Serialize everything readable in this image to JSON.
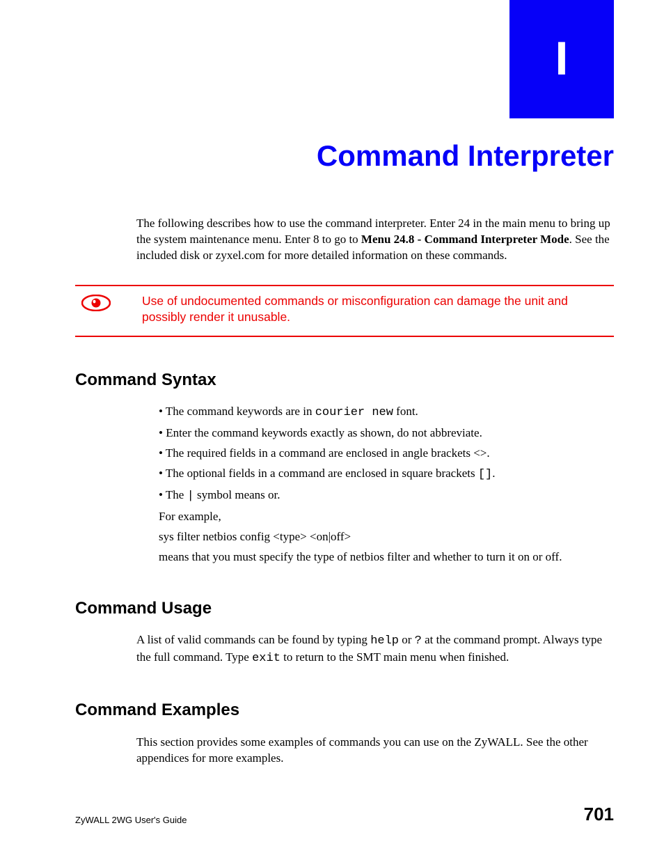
{
  "appendix": {
    "letter": "I"
  },
  "title": "Command Interpreter",
  "intro": {
    "p1a": "The following describes how to use the command interpreter. Enter 24 in the main menu to bring up the system maintenance menu. Enter 8 to go to ",
    "p1b_bold": "Menu 24.8 - Command Interpreter Mode",
    "p1c": ". See the included disk or zyxel.com for more detailed information on these commands."
  },
  "warning": "Use of undocumented commands or misconfiguration can damage the unit and possibly render it unusable.",
  "sections": {
    "syntax": {
      "heading": "Command Syntax",
      "b1a": "The command keywords are in ",
      "b1b_mono": "courier new",
      "b1c": " font.",
      "b2": "Enter the command keywords exactly as shown, do not abbreviate.",
      "b3": "The required fields in a command are enclosed in angle brackets <>.",
      "b4a": "The optional fields in a command are enclosed in square brackets ",
      "b4b_mono": "[]",
      "b4c": ".",
      "b5a": "The ",
      "b5b_mono": "|",
      "b5c": " symbol means or.",
      "ex1": "For example,",
      "ex2": "sys filter netbios config <type> <on|off>",
      "ex3": "means that you must specify the type of netbios filter and whether to turn it on or off."
    },
    "usage": {
      "heading": "Command Usage",
      "p_a": "A list of valid commands can be found by typing ",
      "p_b_mono": "help",
      "p_c": " or ",
      "p_d_mono": "?",
      "p_e": " at the command prompt. Always type the full command. Type ",
      "p_f_mono": "exit",
      "p_g": " to return to the SMT main menu when finished."
    },
    "examples": {
      "heading": "Command Examples",
      "p": "This section provides some examples of commands you can use on the ZyWALL. See the other appendices for more examples."
    }
  },
  "footer": {
    "guide": "ZyWALL 2WG User's Guide",
    "page": "701"
  }
}
